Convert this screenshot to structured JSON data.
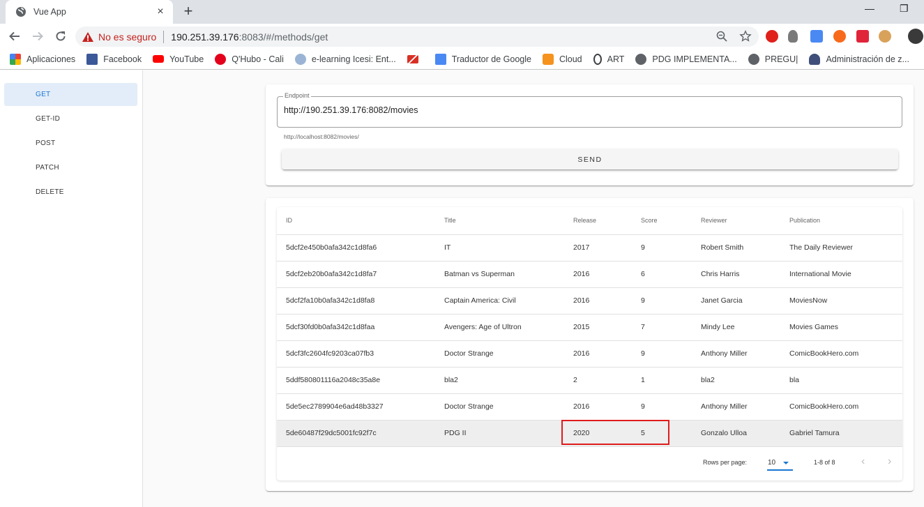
{
  "browser": {
    "tab_title": "Vue App",
    "tab_close": "×",
    "new_tab": "+",
    "security_label": "No es seguro",
    "url_host": "190.251.39.176",
    "url_rest": ":8083/#/methods/get",
    "window_minimize": "—",
    "window_restore": "❐",
    "bookmarks": [
      {
        "label": "Aplicaciones",
        "icon": "apps-grid-icon"
      },
      {
        "label": "Facebook",
        "icon": "facebook-icon"
      },
      {
        "label": "YouTube",
        "icon": "youtube-icon"
      },
      {
        "label": "Q'Hubo - Cali",
        "icon": "qhubo-icon"
      },
      {
        "label": "e-learning Icesi: Ent...",
        "icon": "elearning-icon"
      },
      {
        "label": "",
        "icon": "gmail-icon"
      },
      {
        "label": "Traductor de Google",
        "icon": "google-translate-icon"
      },
      {
        "label": "Cloud",
        "icon": "cloud-icon"
      },
      {
        "label": "ART",
        "icon": "art-icon"
      },
      {
        "label": "PDG IMPLEMENTA...",
        "icon": "globe-icon"
      },
      {
        "label": "PREGU|",
        "icon": "globe-icon"
      },
      {
        "label": "Administración de z...",
        "icon": "admin-icon"
      }
    ]
  },
  "sidebar": {
    "items": [
      {
        "label": "GET",
        "active": true
      },
      {
        "label": "GET-ID",
        "active": false
      },
      {
        "label": "POST",
        "active": false
      },
      {
        "label": "PATCH",
        "active": false
      },
      {
        "label": "DELETE",
        "active": false
      }
    ]
  },
  "request": {
    "endpoint_label": "Endpoint",
    "endpoint_value": "http://190.251.39.176:8082/movies",
    "hint": "http://localhost:8082/movies/",
    "send_label": "SEND"
  },
  "table": {
    "headers": [
      "ID",
      "Title",
      "Release",
      "Score",
      "Reviewer",
      "Publication"
    ],
    "rows": [
      [
        "5dcf2e450b0afa342c1d8fa6",
        "IT",
        "2017",
        "9",
        "Robert Smith",
        "The Daily Reviewer"
      ],
      [
        "5dcf2eb20b0afa342c1d8fa7",
        "Batman vs Superman",
        "2016",
        "6",
        "Chris Harris",
        "International Movie"
      ],
      [
        "5dcf2fa10b0afa342c1d8fa8",
        "Captain America: Civil",
        "2016",
        "9",
        "Janet Garcia",
        "MoviesNow"
      ],
      [
        "5dcf30fd0b0afa342c1d8faa",
        "Avengers: Age of Ultron",
        "2015",
        "7",
        "Mindy Lee",
        "Movies Games"
      ],
      [
        "5dcf3fc2604fc9203ca07fb3",
        "Doctor Strange",
        "2016",
        "9",
        "Anthony Miller",
        "ComicBookHero.com"
      ],
      [
        "5ddf580801116a2048c35a8e",
        "bla2",
        "2",
        "1",
        "bla2",
        "bla"
      ],
      [
        "5de5ec2789904e6ad48b3327",
        "Doctor Strange",
        "2016",
        "9",
        "Anthony Miller",
        "ComicBookHero.com"
      ],
      [
        "5de60487f29dc5001fc92f7c",
        "PDG II",
        "2020",
        "5",
        "Gonzalo Ulloa",
        "Gabriel Tamura"
      ]
    ],
    "selected_row": 7,
    "footer": {
      "rows_per_page_label": "Rows per page:",
      "rows_per_page_value": "10",
      "range": "1-8 of 8",
      "prev": "‹",
      "next": "›"
    }
  },
  "colors": {
    "accent": "#1976d2",
    "active_nav_bg": "#e3edf9",
    "highlight_box": "#e01b1b",
    "insecure_red": "#c5221f"
  }
}
